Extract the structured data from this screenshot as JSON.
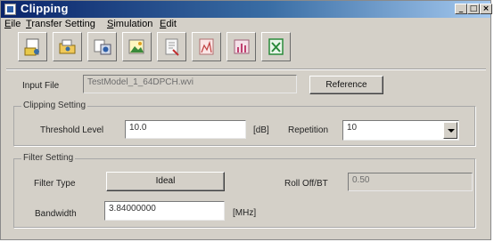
{
  "window": {
    "title": "Clipping",
    "minimize": "_",
    "restore": "□",
    "close": "×"
  },
  "menu": [
    {
      "key": "E",
      "rest": "ile"
    },
    {
      "key": "T",
      "rest": "ransfer Setting"
    },
    {
      "key": "S",
      "rest": "imulation"
    },
    {
      "key": "E",
      "rest": "dit"
    }
  ],
  "toolbar": {
    "icons": [
      "open-file-icon",
      "open-folder-icon",
      "export-icon",
      "image-icon",
      "settings-icon",
      "spectrum-icon",
      "chart-icon",
      "run-icon"
    ]
  },
  "input_file": {
    "label": "Input File",
    "value": "TestModel_1_64DPCH.wvi",
    "reference_button": "Reference"
  },
  "clipping": {
    "group_title": "Clipping Setting",
    "threshold_label": "Threshold Level",
    "threshold_value": "10.0",
    "threshold_unit": "[dB]",
    "repetition_label": "Repetition",
    "repetition_value": "10"
  },
  "filter": {
    "group_title": "Filter Setting",
    "type_label": "Filter Type",
    "type_button": "Ideal",
    "rolloff_label": "Roll Off/BT",
    "rolloff_value": "0.50",
    "bandwidth_label": "Bandwidth",
    "bandwidth_value": "3.84000000",
    "bandwidth_unit": "[MHz]"
  },
  "colors": {
    "titlebar_start": "#0a246a",
    "titlebar_end": "#a6caf0",
    "window_bg": "#d4d0c8"
  }
}
